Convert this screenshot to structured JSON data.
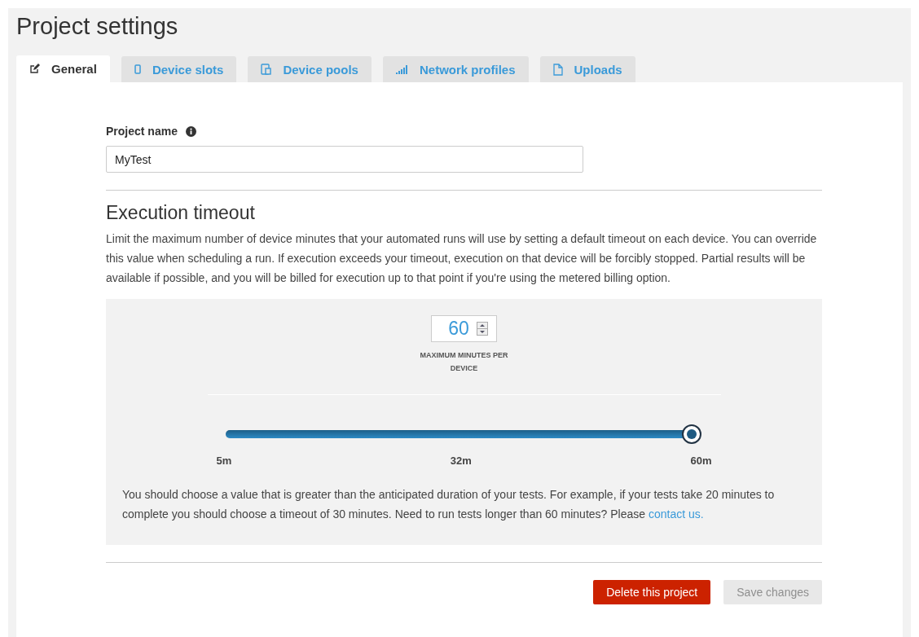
{
  "page": {
    "title": "Project settings"
  },
  "tabs": [
    {
      "label": "General",
      "kind": "edit",
      "selected": true
    },
    {
      "label": "Device slots",
      "kind": "phone",
      "selected": false
    },
    {
      "label": "Device pools",
      "kind": "devices",
      "selected": false
    },
    {
      "label": "Network profiles",
      "kind": "signal",
      "selected": false
    },
    {
      "label": "Uploads",
      "kind": "file",
      "selected": false
    }
  ],
  "project_name": {
    "label": "Project name",
    "value": "MyTest"
  },
  "timeout": {
    "heading": "Execution timeout",
    "description": "Limit the maximum number of device minutes that your automated runs will use by setting a default timeout on each device. You can override this value when scheduling a run. If execution exceeds your timeout, execution on that device will be forcibly stopped. Partial results will be available if possible, and you will be billed for execution up to that point if you're using the metered billing option.",
    "value": "60",
    "value_label": "MAXIMUM MINUTES PER DEVICE",
    "slider": {
      "level": 1
    },
    "ticks": [
      "5m",
      "32m",
      "60m"
    ],
    "help": "You should choose a value that is greater than the anticipated duration of your tests. For example, if your tests take 20 minutes to complete you should choose a timeout of 30 minutes. Need to run tests longer than 60 minutes? Please",
    "help_link": "contact us."
  },
  "buttons": [
    {
      "label": "Delete this project",
      "kind": "danger",
      "disabled": false
    },
    {
      "label": "Save changes",
      "kind": "primary",
      "disabled": true
    }
  ]
}
